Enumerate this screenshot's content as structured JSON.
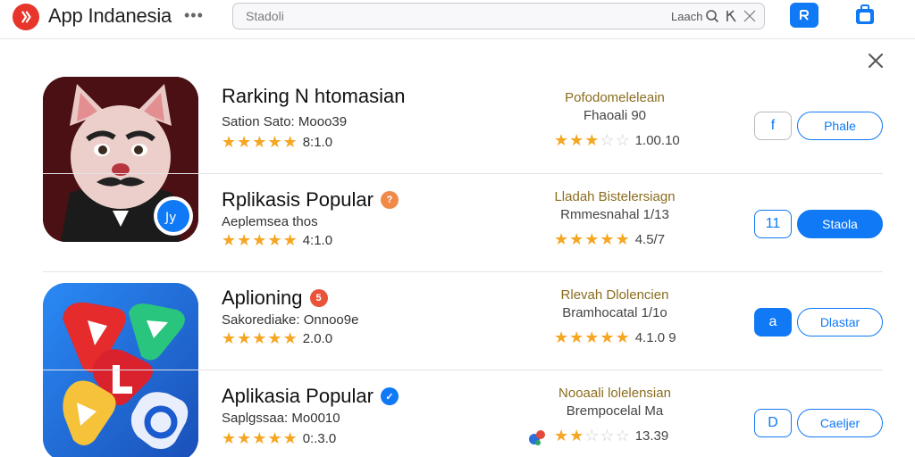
{
  "header": {
    "title": "App Indanesia",
    "more_icon": "ellipsis-icon",
    "search_placeholder": "Stadoli",
    "search_right_label": "Laach",
    "brand_color": "#e8352c",
    "accent_color": "#1079f5"
  },
  "apps": [
    {
      "name": "Rarking N htomasian",
      "badge": "",
      "subtitle": "Sation Sato: Mooo39",
      "rating_text": "8:1.0",
      "stars": 4.5,
      "mid_title": "Pofodomeleleain",
      "mid_subtitle": "Fhaoali 90",
      "mid_rating_text": "1.00.10",
      "mid_stars": 2.5,
      "square_label": "f",
      "pill_label": "Phale"
    },
    {
      "name": "Rplikasis Popular",
      "badge": "?",
      "subtitle": "Aeplemsea thos",
      "rating_text": "4:1.0",
      "stars": 4.5,
      "mid_title": "Lladah Bistelersiagn",
      "mid_subtitle": "Rmmesnahal 1/13",
      "mid_rating_text": "4.5/7",
      "mid_stars": 5,
      "square_label": "11",
      "pill_label": "Staola"
    },
    {
      "name": "Aplioning",
      "badge": "5",
      "subtitle": "Sakorediake: Onnoo9e",
      "rating_text": "2.0.0",
      "stars": 5,
      "mid_title": "Rlevah Dlolencien",
      "mid_subtitle": "Bramhocatal 1/1o",
      "mid_rating_text": "4.1.0 9",
      "mid_stars": 5,
      "square_label": "a",
      "pill_label": "Dlastar"
    },
    {
      "name": "Aplikasia Popular",
      "badge": "✓",
      "subtitle": "Saplgssaa: Mo0010",
      "rating_text": "0:.3.0",
      "stars": 4.5,
      "mid_title": "Nooaali lolelensian",
      "mid_subtitle": "Brempocelal Ma",
      "mid_rating_text": "13.39",
      "mid_stars": 1.5,
      "square_label": "D",
      "pill_label": "Caeljer"
    }
  ]
}
